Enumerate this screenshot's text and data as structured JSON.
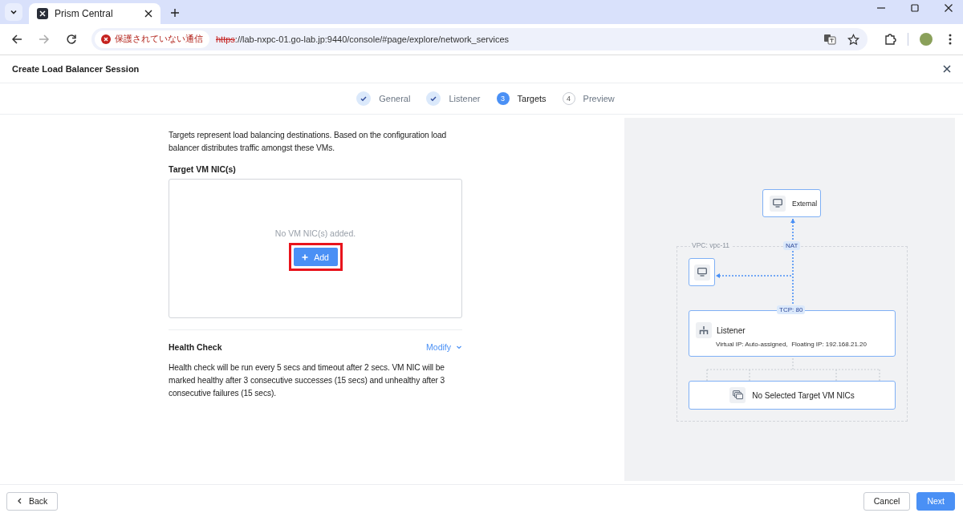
{
  "browser": {
    "tab_title": "Prism Central",
    "security_label": "保護されていない通信",
    "url_scheme": "https",
    "url_rest": "://lab-nxpc-01.go-lab.jp:9440/console/#page/explore/network_services"
  },
  "dialog": {
    "title": "Create Load Balancer Session"
  },
  "steps": [
    {
      "label": "General",
      "done": true,
      "selected": false
    },
    {
      "label": "Listener",
      "done": true,
      "selected": false
    },
    {
      "label": "Targets",
      "done": false,
      "selected": true,
      "number": "3"
    },
    {
      "label": "Preview",
      "done": false,
      "selected": false,
      "number": "4"
    }
  ],
  "form": {
    "intro": "Targets represent load balancing destinations. Based on the configuration load balancer distributes traffic amongst these VMs.",
    "targets_label": "Target VM NIC(s)",
    "empty_text": "No VM NIC(s) added.",
    "add_button": {
      "label": "Add",
      "highlighted": true
    },
    "health_title": "Health Check",
    "modify_link": "Modify",
    "health_text": "Health check will be run every 5 secs and timeout after 2 secs. VM NIC will be marked healthy after 3 consecutive successes (15 secs) and unhealthy after 3 consecutive failures (15 secs)."
  },
  "diagram": {
    "external": "External",
    "vpc_label": "VPC: vpc-11",
    "nat": "NAT",
    "port": "TCP: 80",
    "listener_title": "Listener",
    "listener_detail": "Virtual IP: Auto-assigned,  Floating IP: 192.168.21.20",
    "targets": "No Selected Target VM NICs"
  },
  "footer": {
    "back": "Back",
    "cancel": "Cancel",
    "next": "Next"
  }
}
